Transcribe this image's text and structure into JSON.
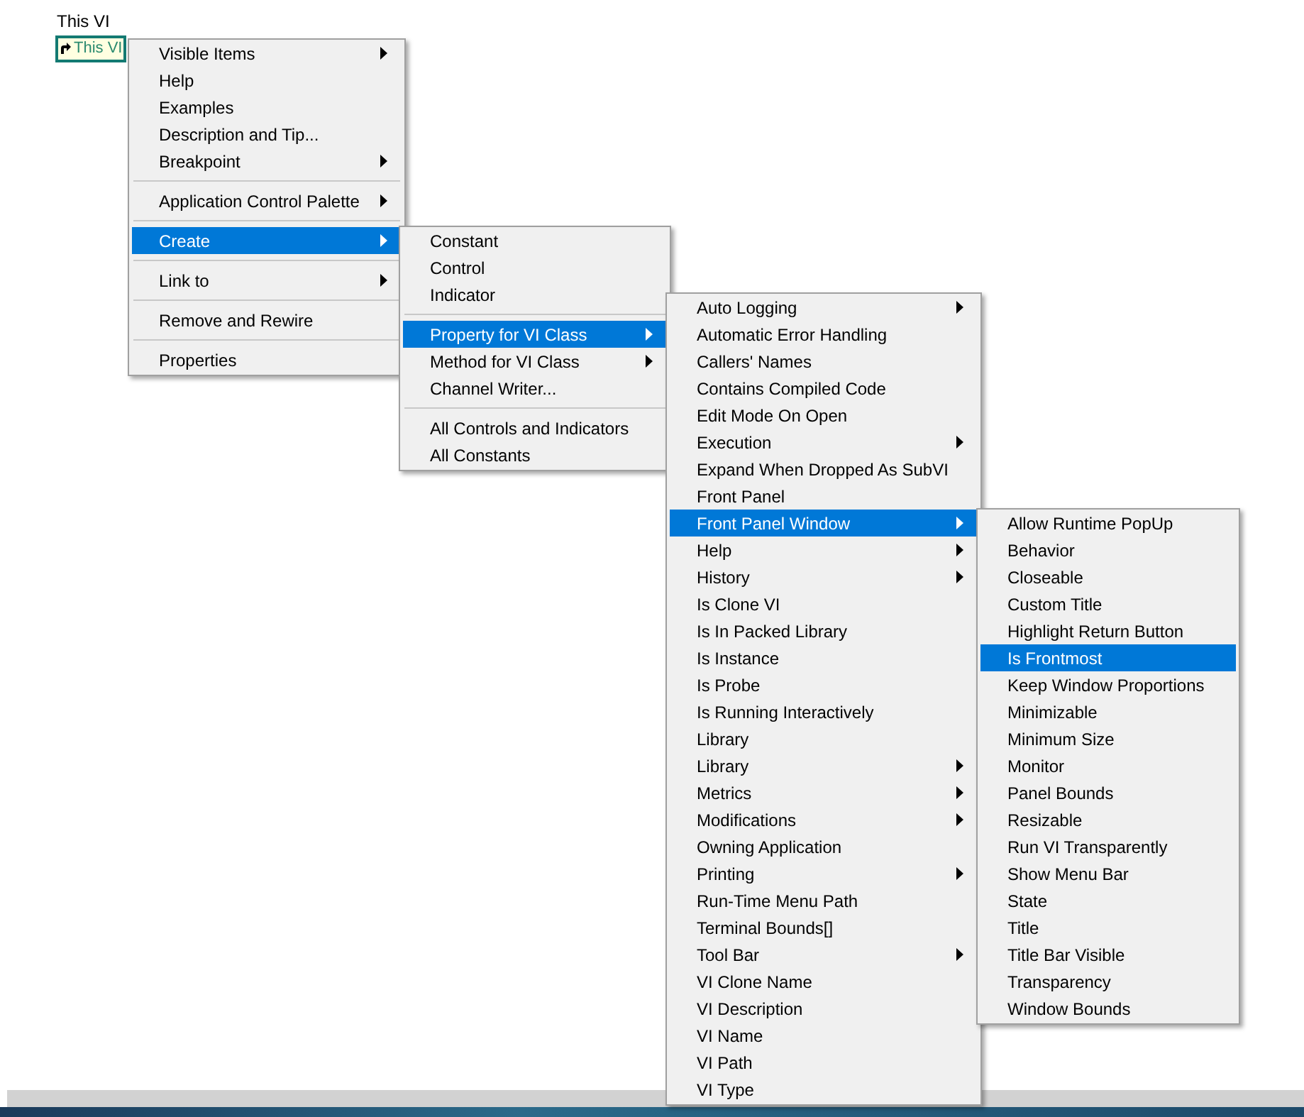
{
  "node_label": "This VI",
  "node": {
    "text": "This VI"
  },
  "menus": [
    {
      "items": [
        {
          "kind": "item",
          "label": "Visible Items",
          "submenu": true,
          "selected": false
        },
        {
          "kind": "item",
          "label": "Help",
          "submenu": false,
          "selected": false
        },
        {
          "kind": "item",
          "label": "Examples",
          "submenu": false,
          "selected": false
        },
        {
          "kind": "item",
          "label": "Description and Tip...",
          "submenu": false,
          "selected": false
        },
        {
          "kind": "item",
          "label": "Breakpoint",
          "submenu": true,
          "selected": false
        },
        {
          "kind": "separator"
        },
        {
          "kind": "item",
          "label": "Application Control Palette",
          "submenu": true,
          "selected": false
        },
        {
          "kind": "separator"
        },
        {
          "kind": "item",
          "label": "Create",
          "submenu": true,
          "selected": true
        },
        {
          "kind": "separator"
        },
        {
          "kind": "item",
          "label": "Link to",
          "submenu": true,
          "selected": false
        },
        {
          "kind": "separator"
        },
        {
          "kind": "item",
          "label": "Remove and Rewire",
          "submenu": false,
          "selected": false
        },
        {
          "kind": "separator"
        },
        {
          "kind": "item",
          "label": "Properties",
          "submenu": false,
          "selected": false
        }
      ]
    },
    {
      "items": [
        {
          "kind": "item",
          "label": "Constant",
          "submenu": false,
          "selected": false
        },
        {
          "kind": "item",
          "label": "Control",
          "submenu": false,
          "selected": false
        },
        {
          "kind": "item",
          "label": "Indicator",
          "submenu": false,
          "selected": false
        },
        {
          "kind": "separator"
        },
        {
          "kind": "item",
          "label": "Property for VI Class",
          "submenu": true,
          "selected": true
        },
        {
          "kind": "item",
          "label": "Method for VI Class",
          "submenu": true,
          "selected": false
        },
        {
          "kind": "item",
          "label": "Channel Writer...",
          "submenu": false,
          "selected": false
        },
        {
          "kind": "separator"
        },
        {
          "kind": "item",
          "label": "All Controls and Indicators",
          "submenu": false,
          "selected": false
        },
        {
          "kind": "item",
          "label": "All Constants",
          "submenu": false,
          "selected": false
        }
      ]
    },
    {
      "items": [
        {
          "kind": "item",
          "label": "Auto Logging",
          "submenu": true,
          "selected": false
        },
        {
          "kind": "item",
          "label": "Automatic Error Handling",
          "submenu": false,
          "selected": false
        },
        {
          "kind": "item",
          "label": "Callers' Names",
          "submenu": false,
          "selected": false
        },
        {
          "kind": "item",
          "label": "Contains Compiled Code",
          "submenu": false,
          "selected": false
        },
        {
          "kind": "item",
          "label": "Edit Mode On Open",
          "submenu": false,
          "selected": false
        },
        {
          "kind": "item",
          "label": "Execution",
          "submenu": true,
          "selected": false
        },
        {
          "kind": "item",
          "label": "Expand When Dropped As SubVI",
          "submenu": false,
          "selected": false
        },
        {
          "kind": "item",
          "label": "Front Panel",
          "submenu": false,
          "selected": false
        },
        {
          "kind": "item",
          "label": "Front Panel Window",
          "submenu": true,
          "selected": true
        },
        {
          "kind": "item",
          "label": "Help",
          "submenu": true,
          "selected": false
        },
        {
          "kind": "item",
          "label": "History",
          "submenu": true,
          "selected": false
        },
        {
          "kind": "item",
          "label": "Is Clone VI",
          "submenu": false,
          "selected": false
        },
        {
          "kind": "item",
          "label": "Is In Packed Library",
          "submenu": false,
          "selected": false
        },
        {
          "kind": "item",
          "label": "Is Instance",
          "submenu": false,
          "selected": false
        },
        {
          "kind": "item",
          "label": "Is Probe",
          "submenu": false,
          "selected": false
        },
        {
          "kind": "item",
          "label": "Is Running Interactively",
          "submenu": false,
          "selected": false
        },
        {
          "kind": "item",
          "label": "Library",
          "submenu": false,
          "selected": false
        },
        {
          "kind": "item",
          "label": "Library",
          "submenu": true,
          "selected": false
        },
        {
          "kind": "item",
          "label": "Metrics",
          "submenu": true,
          "selected": false
        },
        {
          "kind": "item",
          "label": "Modifications",
          "submenu": true,
          "selected": false
        },
        {
          "kind": "item",
          "label": "Owning Application",
          "submenu": false,
          "selected": false
        },
        {
          "kind": "item",
          "label": "Printing",
          "submenu": true,
          "selected": false
        },
        {
          "kind": "item",
          "label": "Run-Time Menu Path",
          "submenu": false,
          "selected": false
        },
        {
          "kind": "item",
          "label": "Terminal Bounds[]",
          "submenu": false,
          "selected": false
        },
        {
          "kind": "item",
          "label": "Tool Bar",
          "submenu": true,
          "selected": false
        },
        {
          "kind": "item",
          "label": "VI Clone Name",
          "submenu": false,
          "selected": false
        },
        {
          "kind": "item",
          "label": "VI Description",
          "submenu": false,
          "selected": false
        },
        {
          "kind": "item",
          "label": "VI Name",
          "submenu": false,
          "selected": false
        },
        {
          "kind": "item",
          "label": "VI Path",
          "submenu": false,
          "selected": false
        },
        {
          "kind": "item",
          "label": "VI Type",
          "submenu": false,
          "selected": false
        }
      ]
    },
    {
      "items": [
        {
          "kind": "item",
          "label": "Allow Runtime PopUp",
          "submenu": false,
          "selected": false
        },
        {
          "kind": "item",
          "label": "Behavior",
          "submenu": false,
          "selected": false
        },
        {
          "kind": "item",
          "label": "Closeable",
          "submenu": false,
          "selected": false
        },
        {
          "kind": "item",
          "label": "Custom Title",
          "submenu": false,
          "selected": false
        },
        {
          "kind": "item",
          "label": "Highlight Return Button",
          "submenu": false,
          "selected": false
        },
        {
          "kind": "item",
          "label": "Is Frontmost",
          "submenu": false,
          "selected": true
        },
        {
          "kind": "item",
          "label": "Keep Window Proportions",
          "submenu": false,
          "selected": false
        },
        {
          "kind": "item",
          "label": "Minimizable",
          "submenu": false,
          "selected": false
        },
        {
          "kind": "item",
          "label": "Minimum Size",
          "submenu": false,
          "selected": false
        },
        {
          "kind": "item",
          "label": "Monitor",
          "submenu": false,
          "selected": false
        },
        {
          "kind": "item",
          "label": "Panel Bounds",
          "submenu": false,
          "selected": false
        },
        {
          "kind": "item",
          "label": "Resizable",
          "submenu": false,
          "selected": false
        },
        {
          "kind": "item",
          "label": "Run VI Transparently",
          "submenu": false,
          "selected": false
        },
        {
          "kind": "item",
          "label": "Show Menu Bar",
          "submenu": false,
          "selected": false
        },
        {
          "kind": "item",
          "label": "State",
          "submenu": false,
          "selected": false
        },
        {
          "kind": "item",
          "label": "Title",
          "submenu": false,
          "selected": false
        },
        {
          "kind": "item",
          "label": "Title Bar Visible",
          "submenu": false,
          "selected": false
        },
        {
          "kind": "item",
          "label": "Transparency",
          "submenu": false,
          "selected": false
        },
        {
          "kind": "item",
          "label": "Window Bounds",
          "submenu": false,
          "selected": false
        }
      ]
    }
  ]
}
